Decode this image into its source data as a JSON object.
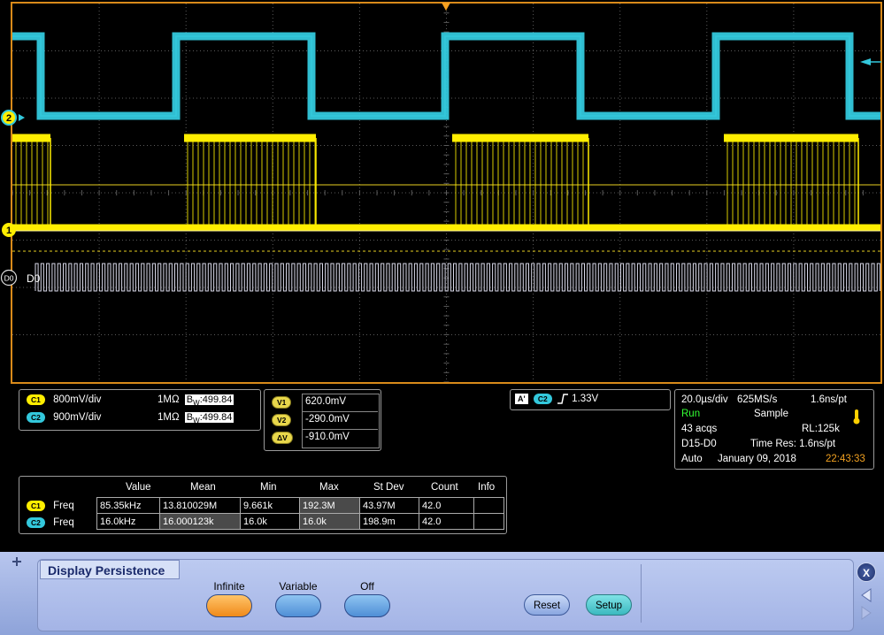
{
  "channels": [
    {
      "badge": "C1",
      "scale": "800mV/div",
      "impedance": "1MΩ",
      "bw_prefix": "B",
      "bw_sub": "W",
      "bw_value": ":499.84"
    },
    {
      "badge": "C2",
      "scale": "900mV/div",
      "impedance": "1MΩ",
      "bw_prefix": "B",
      "bw_sub": "W",
      "bw_value": ":499.84"
    }
  ],
  "channel_markers": {
    "ch2": "2",
    "ch1": "1",
    "digital": "D0",
    "digital_label": "D0"
  },
  "cursors": [
    {
      "badge": "V1",
      "value": "620.0mV"
    },
    {
      "badge": "V2",
      "value": "-290.0mV"
    },
    {
      "badge": "ΔV",
      "value": "-910.0mV"
    }
  ],
  "trigger": {
    "mode_badge": "A'",
    "source_badge": "C2",
    "slope_icon": "rising-edge",
    "level": "1.33V"
  },
  "acquisition": {
    "timebase": "20.0µs/div",
    "sample_rate": "625MS/s",
    "sample_interval": "1.6ns/pt",
    "state": "Run",
    "mode": "Sample",
    "acqs": "43 acqs",
    "record_length": "RL:125k",
    "digital": "D15-D0",
    "time_res": "Time Res: 1.6ns/pt",
    "trigger_mode": "Auto",
    "date": "January 09, 2018",
    "time": "22:43:33"
  },
  "measurements": {
    "headers": [
      "Value",
      "Mean",
      "Min",
      "Max",
      "St Dev",
      "Count",
      "Info"
    ],
    "rows": [
      {
        "badge": "C1",
        "type": "Freq",
        "cells": [
          "85.35kHz",
          "13.810029M",
          "9.661k",
          "192.3M",
          "43.97M",
          "42.0",
          ""
        ]
      },
      {
        "badge": "C2",
        "type": "Freq",
        "cells": [
          "16.0kHz",
          "16.000123k",
          "16.0k",
          "16.0k",
          "198.9m",
          "42.0",
          ""
        ]
      }
    ]
  },
  "menu": {
    "title": "Display Persistence",
    "options": [
      "Infinite",
      "Variable",
      "Off"
    ],
    "selected": "Infinite",
    "reset_label": "Reset",
    "setup_label": "Setup",
    "close_label": "X"
  },
  "colors": {
    "ch1": "#ffee00",
    "ch2": "#33c8dc",
    "graticule_frame": "#d98a1a",
    "grid": "#5a5a5a",
    "menu_selected": "#f08a1a",
    "status_run": "#33ff33",
    "clock": "#f0a020"
  }
}
